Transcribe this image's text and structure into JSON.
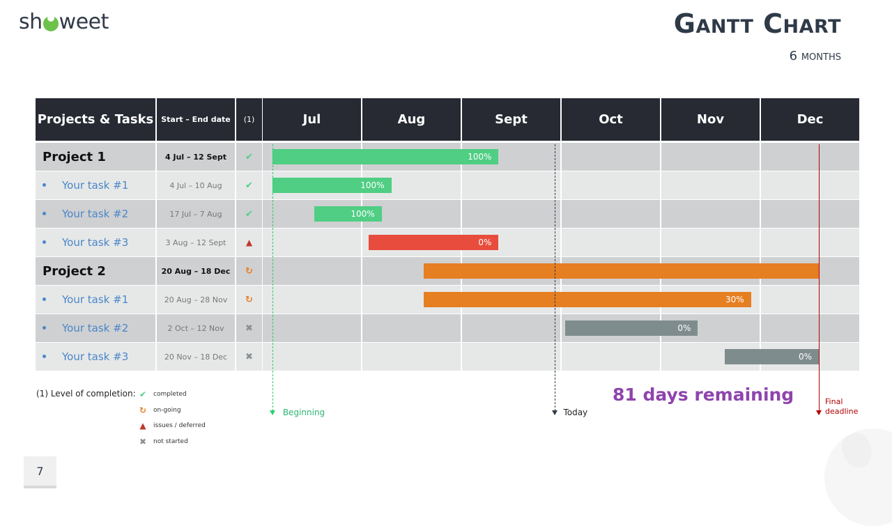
{
  "header": {
    "logo_text_left": "sh",
    "logo_text_right": "weet",
    "title": "Gantt Chart",
    "subtitle": "6 months"
  },
  "table": {
    "col_projects": "Projects & Tasks",
    "col_dates": "Start – End date",
    "col_status": "(1)",
    "months": [
      "Jul",
      "Aug",
      "Sept",
      "Oct",
      "Nov",
      "Dec"
    ]
  },
  "colors": {
    "completed": "#4fce84",
    "issues": "#e74c3c",
    "ongoing": "#e67e22",
    "not_started": "#7f8c8d",
    "header_bg": "#272a33",
    "beginning": "#2ecc71",
    "today": "#2f3a48",
    "deadline": "#b00000",
    "remaining": "#8e44ad"
  },
  "status_icons": {
    "completed": "✔",
    "ongoing": "↻",
    "issues": "▲",
    "not_started": "✖"
  },
  "chart_data": {
    "type": "gantt",
    "title": "Gantt Chart",
    "subtitle": "6 months",
    "x_range": [
      "1 Jul",
      "31 Dec"
    ],
    "categories": [
      "Jul",
      "Aug",
      "Sept",
      "Oct",
      "Nov",
      "Dec"
    ],
    "rows": [
      {
        "kind": "project",
        "name": "Project 1",
        "dates": "4 Jul – 12 Sept",
        "status": "completed",
        "start_day": 3,
        "end_day": 73,
        "progress_label": "100%",
        "color": "completed"
      },
      {
        "kind": "task",
        "name": "Your task #1",
        "dates": "4 Jul – 10 Aug",
        "status": "completed",
        "start_day": 3,
        "end_day": 40,
        "progress_label": "100%",
        "color": "completed"
      },
      {
        "kind": "task",
        "name": "Your task #2",
        "dates": "17 Jul – 7 Aug",
        "status": "completed",
        "start_day": 16,
        "end_day": 37,
        "progress_label": "100%",
        "color": "completed"
      },
      {
        "kind": "task",
        "name": "Your task #3",
        "dates": "3 Aug – 12 Sept",
        "status": "issues",
        "start_day": 33,
        "end_day": 73,
        "progress_label": "0%",
        "color": "issues"
      },
      {
        "kind": "project",
        "name": "Project 2",
        "dates": "20 Aug – 18 Dec",
        "status": "ongoing",
        "start_day": 50,
        "end_day": 171,
        "progress_label": "",
        "color": "ongoing"
      },
      {
        "kind": "task",
        "name": "Your task #1",
        "dates": "20 Aug – 28 Nov",
        "status": "ongoing",
        "start_day": 50,
        "end_day": 150,
        "progress_label": "30%",
        "color": "ongoing"
      },
      {
        "kind": "task",
        "name": "Your task #2",
        "dates": "2 Oct – 12 Nov",
        "status": "not_started",
        "start_day": 93,
        "end_day": 134,
        "progress_label": "0%",
        "color": "not_started"
      },
      {
        "kind": "task",
        "name": "Your task #3",
        "dates": "20 Nov – 18 Dec",
        "status": "not_started",
        "start_day": 142,
        "end_day": 171,
        "progress_label": "0%",
        "color": "not_started"
      }
    ],
    "markers": [
      {
        "name": "Beginning",
        "day": 3,
        "color": "beginning",
        "style": "dashed"
      },
      {
        "name": "Today",
        "day": 90,
        "color": "today",
        "style": "dashed"
      },
      {
        "name": "Final deadline",
        "day": 171,
        "color": "deadline",
        "style": "solid"
      }
    ],
    "annotation": "81 days remaining"
  },
  "legend": {
    "title": "(1) Level of completion:",
    "items": [
      {
        "key": "completed",
        "label": "completed"
      },
      {
        "key": "ongoing",
        "label": "on-going"
      },
      {
        "key": "issues",
        "label": "issues / deferred"
      },
      {
        "key": "not_started",
        "label": "not started"
      }
    ]
  },
  "markers_text": {
    "beginning": "Beginning",
    "today": "Today",
    "deadline_line1": "Final",
    "deadline_line2": "deadline",
    "remaining": "81 days remaining"
  },
  "page_number": "7"
}
